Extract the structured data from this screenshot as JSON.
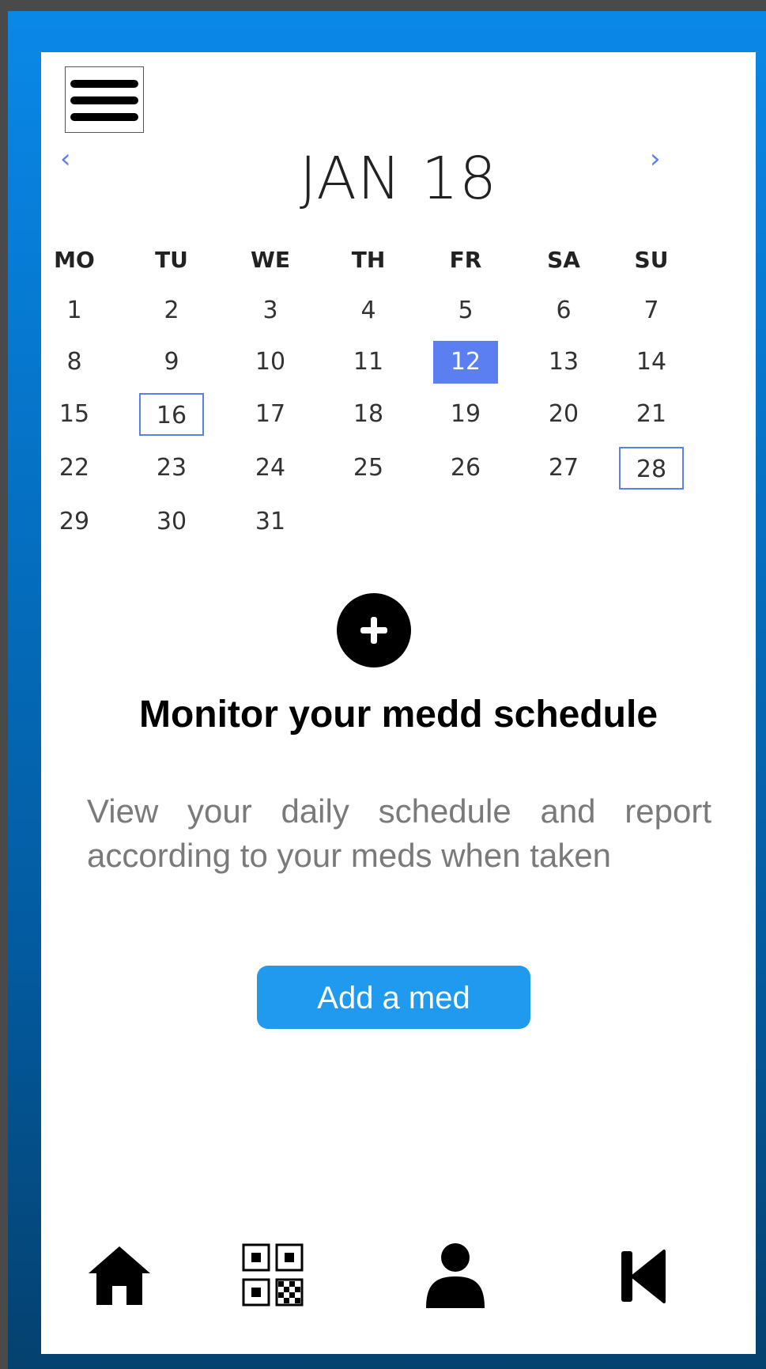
{
  "calendar": {
    "month_title": "JAN 18",
    "prev_arrow": "‹",
    "next_arrow": "›",
    "weekdays": [
      "MO",
      "TU",
      "WE",
      "TH",
      "FR",
      "SA",
      "SU"
    ],
    "weeks": [
      [
        "1",
        "2",
        "3",
        "4",
        "5",
        "6",
        "7"
      ],
      [
        "8",
        "9",
        "10",
        "11",
        "12",
        "13",
        "14"
      ],
      [
        "15",
        "16",
        "17",
        "18",
        "19",
        "20",
        "21"
      ],
      [
        "22",
        "23",
        "24",
        "25",
        "26",
        "27",
        "28"
      ],
      [
        "29",
        "30",
        "31"
      ]
    ],
    "selected_day": "12",
    "marked_days": [
      "16",
      "28"
    ]
  },
  "main": {
    "headline": "Monitor your medd schedule",
    "description": "View your daily schedule and report according to your meds when taken",
    "add_med_label": "Add a med"
  },
  "bottom_nav": {
    "items": [
      {
        "icon": "home-icon"
      },
      {
        "icon": "qr-code-icon"
      },
      {
        "icon": "user-icon"
      },
      {
        "icon": "skip-back-icon"
      }
    ]
  },
  "colors": {
    "accent": "#5b7ff0",
    "button": "#1f9aee",
    "frame_top": "#0a88e8",
    "frame_bottom": "#04416f"
  }
}
